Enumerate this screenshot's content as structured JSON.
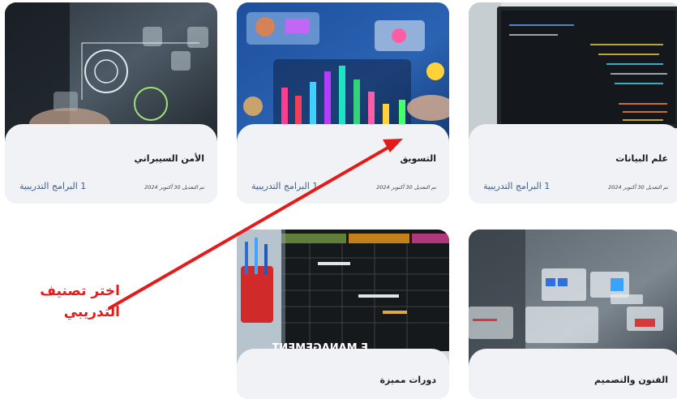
{
  "cards": [
    {
      "title": "الأمن السيبراني",
      "date": "تم التعديل 30 أكتوبر 2024",
      "programs": "1 البرامج التدريبية"
    },
    {
      "title": "التسويق",
      "date": "تم التعديل 30 أكتوبر 2024",
      "programs": "1 البرامج التدريبية"
    },
    {
      "title": "علم البيانات",
      "date": "تم التعديل 30 أكتوبر 2024",
      "programs": "1 البرامج التدريبية"
    },
    {
      "title": "دورات مميزة"
    },
    {
      "title": "الفنون والتصميم"
    }
  ],
  "callout": {
    "line1": "اختر تصنيف",
    "line2": "التدريبي"
  },
  "image_text": {
    "management": "E MANAGEMENT"
  },
  "colors": {
    "accent_text": "#3f5d84",
    "callout": "#e31b1b"
  }
}
